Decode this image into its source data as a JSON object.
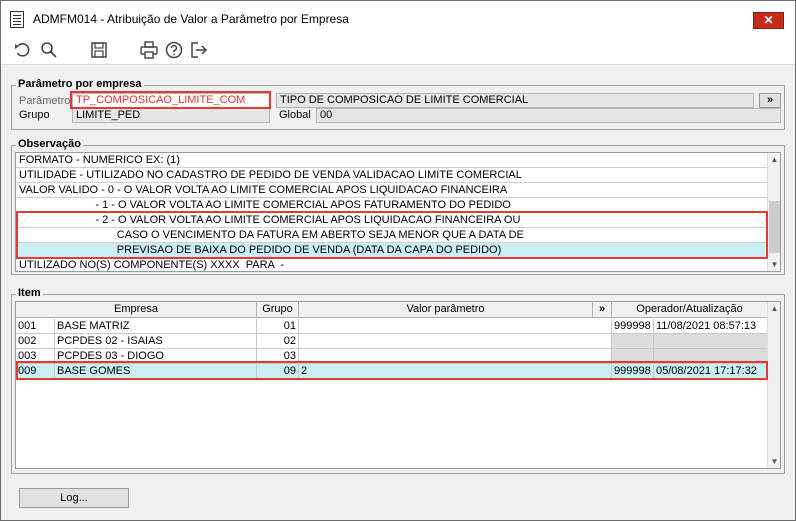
{
  "window": {
    "title": "ADMFM014 - Atribuição de Valor a Parâmetro por Empresa",
    "close": "✕"
  },
  "toolbar": {
    "icons": [
      "undo-icon",
      "search-icon",
      "save-icon",
      "print-icon",
      "help-icon",
      "exit-icon"
    ]
  },
  "parametro_group": {
    "title": "Parâmetro por empresa",
    "parametro_label": "Parâmetro",
    "parametro_value": "TP_COMPOSICAO_LIMITE_COM",
    "descricao_value": "TIPO DE COMPOSICAO DE LIMITE COMERCIAL",
    "expand_label": "»",
    "grupo_label": "Grupo",
    "grupo_value": "LIMITE_PED",
    "global_label": "Global",
    "global_value": "00"
  },
  "observacao": {
    "title": "Observação",
    "lines": [
      "FORMATO - NUMERICO EX: (1)",
      "UTILIDADE - UTILIZADO NO CADASTRO DE PEDIDO DE VENDA VALIDACAO LIMITE COMERCIAL",
      "VALOR VALIDO - 0 - O VALOR VOLTA AO LIMITE COMERCIAL APOS LIQUIDACAO FINANCEIRA",
      "                         - 1 - O VALOR VOLTA AO LIMITE COMERCIAL APOS FATURAMENTO DO PEDIDO",
      "                         - 2 - O VALOR VOLTA AO LIMITE COMERCIAL APOS LIQUIDACAO FINANCEIRA OU",
      "                                CASO O VENCIMENTO DA FATURA EM ABERTO SEJA MENOR QUE A DATA DE",
      "                                PREVISAO DE BAIXA DO PEDIDO DE VENDA (DATA DA CAPA DO PEDIDO)",
      "UTILIZADO NO(S) COMPONENTE(S) XXXX  PARA  -"
    ]
  },
  "item": {
    "title": "Item",
    "headers": {
      "empresa": "Empresa",
      "grupo": "Grupo",
      "valor": "Valor parâmetro",
      "expand": "»",
      "operador": "Operador/Atualização"
    },
    "rows": [
      {
        "codigo": "001",
        "nome": "BASE MATRIZ",
        "grupo": "01",
        "valor": "",
        "operador": "999998",
        "data": "11/08/2021 08:57:13"
      },
      {
        "codigo": "002",
        "nome": "PCPDES 02 - ISAIAS",
        "grupo": "02",
        "valor": "",
        "operador": "",
        "data": ""
      },
      {
        "codigo": "003",
        "nome": "PCPDES 03 - DIOGO",
        "grupo": "03",
        "valor": "",
        "operador": "",
        "data": ""
      },
      {
        "codigo": "009",
        "nome": "BASE GOMES",
        "grupo": "09",
        "valor": "2",
        "operador": "999998",
        "data": "05/08/2021 17:17:32"
      }
    ]
  },
  "footer": {
    "log_label": "Log..."
  },
  "colors": {
    "selection": "#c9eef4",
    "highlight": "#e53935",
    "close": "#c42b1c"
  }
}
